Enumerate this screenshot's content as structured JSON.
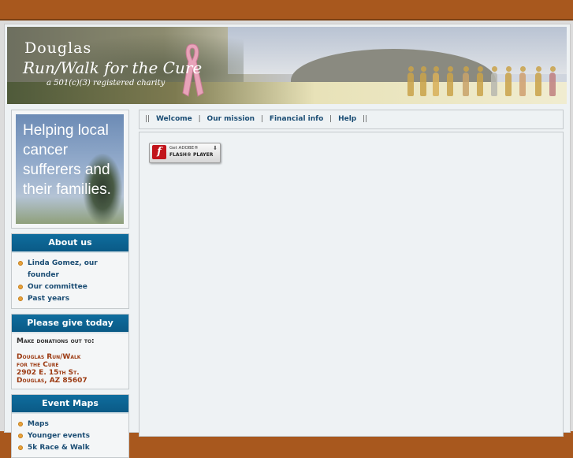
{
  "header": {
    "title_line1": "Douglas",
    "title_line2": "Run/Walk for the Cure",
    "title_line3": "a 501(c)(3) registered charity"
  },
  "promo": {
    "text": "Helping local cancer sufferers and their families."
  },
  "about": {
    "heading": "About us",
    "items": [
      {
        "label": "Linda Gomez, our founder"
      },
      {
        "label": "Our committee"
      },
      {
        "label": "Past years"
      }
    ]
  },
  "give": {
    "heading": "Please give today",
    "make_label": "Make donations out to:",
    "address_lines": [
      "Douglas Run/Walk",
      "for the Cure",
      "2902 E. 15th St.",
      "Douglas, AZ 85607"
    ]
  },
  "maps": {
    "heading": "Event Maps",
    "items": [
      {
        "label": "Maps"
      },
      {
        "label": "Younger events"
      },
      {
        "label": "5k Race & Walk"
      }
    ]
  },
  "nav": {
    "items": [
      {
        "label": "Welcome"
      },
      {
        "label": "Our mission"
      },
      {
        "label": "Financial info"
      },
      {
        "label": "Help"
      }
    ]
  },
  "flash": {
    "line1": "Get ADOBE®",
    "line2": "FLASH® PLAYER",
    "icon_letter": "f"
  },
  "colors": {
    "outer": "#a8581e",
    "panel_header": "#0f6d9e",
    "link": "#1b4d74",
    "address": "#9c3a12"
  }
}
